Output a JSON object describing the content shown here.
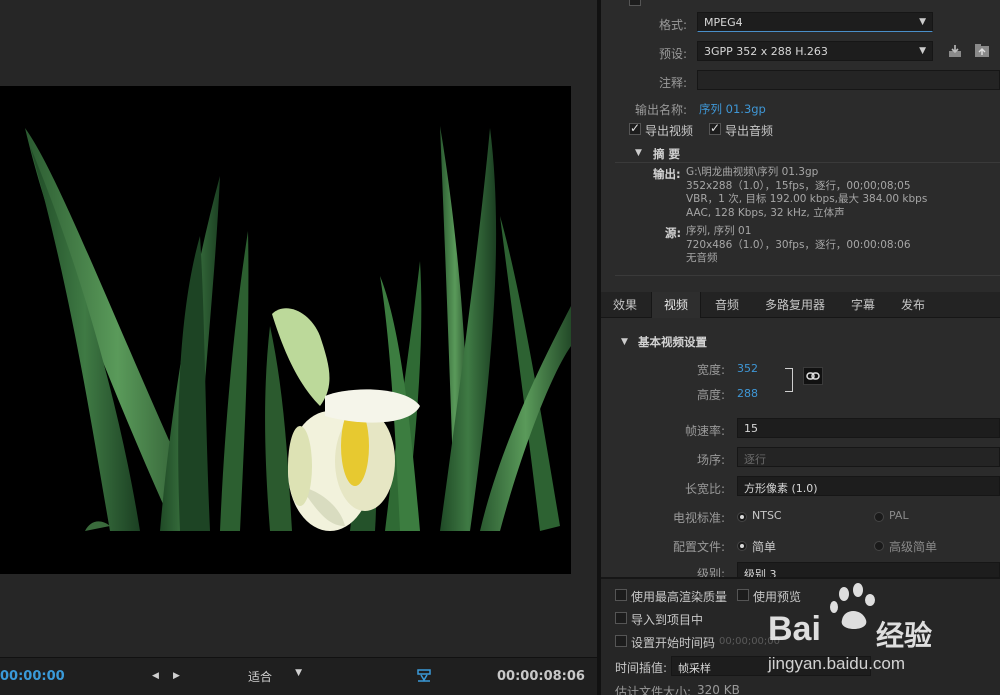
{
  "preview": {
    "timecode_start": "00:00:00",
    "timecode_end": "00:00:08:06",
    "fit_label": "适合",
    "mark_in_icon": "triangle-left-icon",
    "mark_out_icon": "triangle-right-icon",
    "export_range_icon": "export-range-icon"
  },
  "export_settings": {
    "format_label": "格式:",
    "format_value": "MPEG4",
    "preset_label": "预设:",
    "preset_value": "3GPP 352 x 288 H.263",
    "comment_label": "注释:",
    "comment_value": "",
    "output_name_label": "输出名称:",
    "output_name_value": "序列 01.3gp",
    "export_video_label": "导出视频",
    "export_audio_label": "导出音频",
    "summary_title": "摘 要",
    "output_head": "输出:",
    "output_lines": [
      "G:\\明龙曲视频\\序列 01.3gp",
      "352x288（1.0），15fps，逐行，00;00;08;05",
      "VBR，1 次, 目标 192.00  kbps,最大 384.00  kbps",
      "AAC, 128 Kbps, 32  kHz, 立体声"
    ],
    "source_head": "源:",
    "source_lines": [
      "序列, 序列 01",
      "720x486（1.0），30fps，逐行，00:00:08:06",
      "无音频"
    ]
  },
  "tabs": [
    "效果",
    "视频",
    "音频",
    "多路复用器",
    "字幕",
    "发布"
  ],
  "video_settings": {
    "section_title": "基本视频设置",
    "width_label": "宽度:",
    "width_value": "352",
    "height_label": "高度:",
    "height_value": "288",
    "framerate_label": "帧速率:",
    "framerate_value": "15",
    "field_order_label": "场序:",
    "field_order_value": "逐行",
    "aspect_label": "长宽比:",
    "aspect_value": "方形像素 (1.0)",
    "tv_standard_label": "电视标准:",
    "tv_ntsc": "NTSC",
    "tv_pal": "PAL",
    "profile_label": "配置文件:",
    "profile_simple": "简单",
    "profile_advanced": "高级简单",
    "level_label": "级别:",
    "level_value": "级别 3"
  },
  "lower": {
    "max_render_label": "使用最高渲染质量",
    "use_preview_label": "使用预览",
    "import_project_label": "导入到项目中",
    "set_start_tc_label": "设置开始时间码",
    "start_tc_value": "00;00;00;00",
    "time_interp_label": "时间插值:",
    "time_interp_value": "帧采样",
    "filesize_label": "估计文件大小:",
    "filesize_value": "320 KB"
  },
  "watermark": {
    "brand": "Bai",
    "brand2": "经验",
    "url": "jingyan.baidu.com"
  },
  "colors": {
    "accent_blue": "#3f97d6",
    "panel_bg": "#2b2b2b",
    "input_bg": "#1d1d1d"
  }
}
